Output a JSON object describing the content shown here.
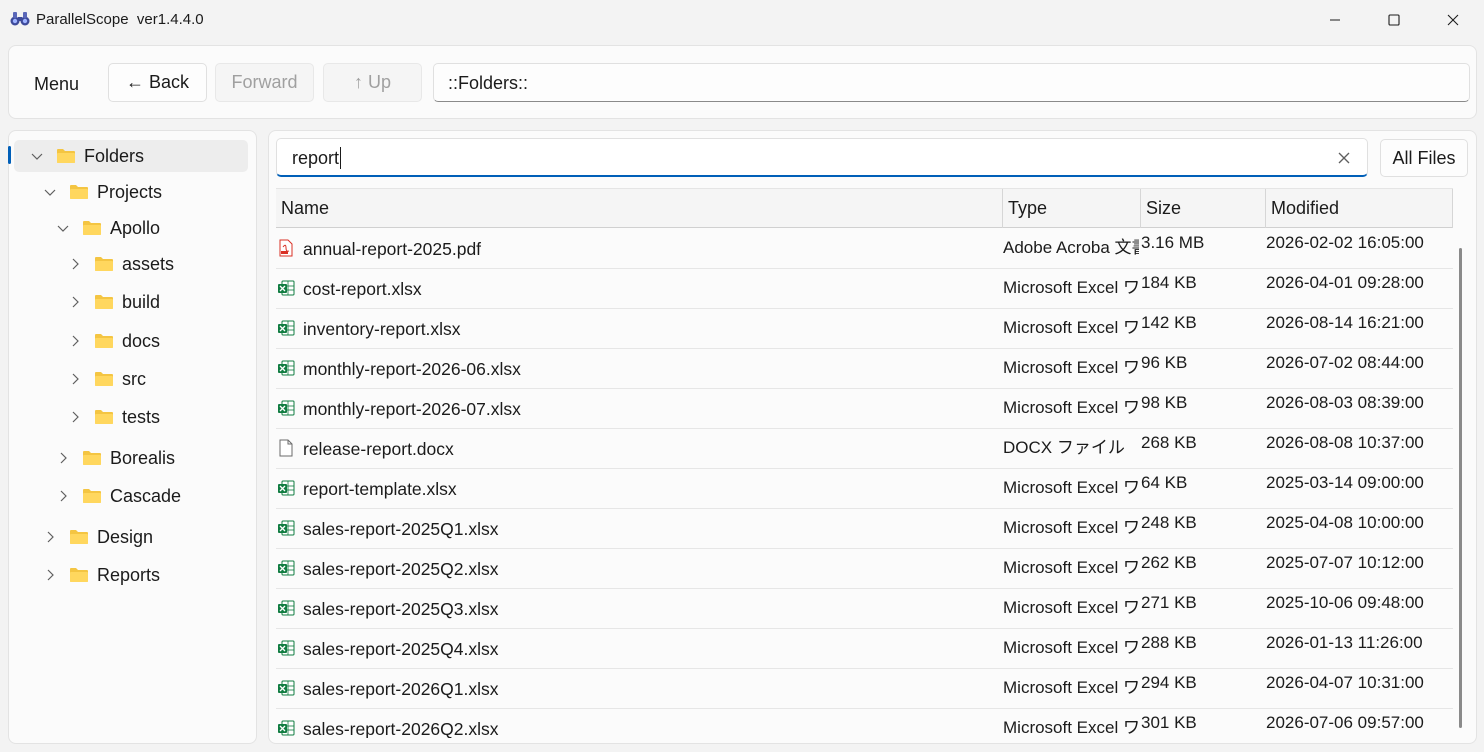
{
  "window": {
    "title": "ParallelScope  ver1.4.4.0",
    "icon": "binoculars-icon"
  },
  "toolbar": {
    "menu": "Menu",
    "back": "← Back",
    "forward": "Forward",
    "up": "↑ Up",
    "path": "::Folders::"
  },
  "tree": {
    "items": [
      {
        "label": "Folders",
        "expanded": true,
        "selected": true
      },
      {
        "label": "Projects",
        "expanded": true
      },
      {
        "label": "Apollo",
        "expanded": true
      },
      {
        "label": "assets",
        "expanded": false
      },
      {
        "label": "build",
        "expanded": false
      },
      {
        "label": "docs",
        "expanded": false
      },
      {
        "label": "src",
        "expanded": false
      },
      {
        "label": "tests",
        "expanded": false
      },
      {
        "label": "Borealis",
        "expanded": false
      },
      {
        "label": "Cascade",
        "expanded": false
      },
      {
        "label": "Design",
        "expanded": false
      },
      {
        "label": "Reports",
        "expanded": false
      }
    ]
  },
  "search": {
    "value": "report",
    "filter": "All Files"
  },
  "table": {
    "columns": [
      "Name",
      "Type",
      "Size",
      "Modified"
    ],
    "rows": [
      {
        "name": "annual-report-2025.pdf",
        "icon": "pdf",
        "type": "Adobe Acroba 文書",
        "size": "3.16 MB",
        "modified": "2026-02-02 16:05:00"
      },
      {
        "name": "cost-report.xlsx",
        "icon": "excel",
        "type": "Microsoft Excel ワークシート",
        "size": "184 KB",
        "modified": "2026-04-01 09:28:00"
      },
      {
        "name": "inventory-report.xlsx",
        "icon": "excel",
        "type": "Microsoft Excel ワークシート",
        "size": "142 KB",
        "modified": "2026-08-14 16:21:00"
      },
      {
        "name": "monthly-report-2026-06.xlsx",
        "icon": "excel",
        "type": "Microsoft Excel ワークシート",
        "size": "96 KB",
        "modified": "2026-07-02 08:44:00"
      },
      {
        "name": "monthly-report-2026-07.xlsx",
        "icon": "excel",
        "type": "Microsoft Excel ワークシート",
        "size": "98 KB",
        "modified": "2026-08-03 08:39:00"
      },
      {
        "name": "release-report.docx",
        "icon": "file",
        "type": "DOCX ファイル",
        "size": "268 KB",
        "modified": "2026-08-08 10:37:00"
      },
      {
        "name": "report-template.xlsx",
        "icon": "excel",
        "type": "Microsoft Excel ワークシート",
        "size": "64 KB",
        "modified": "2025-03-14 09:00:00"
      },
      {
        "name": "sales-report-2025Q1.xlsx",
        "icon": "excel",
        "type": "Microsoft Excel ワークシート",
        "size": "248 KB",
        "modified": "2025-04-08 10:00:00"
      },
      {
        "name": "sales-report-2025Q2.xlsx",
        "icon": "excel",
        "type": "Microsoft Excel ワークシート",
        "size": "262 KB",
        "modified": "2025-07-07 10:12:00"
      },
      {
        "name": "sales-report-2025Q3.xlsx",
        "icon": "excel",
        "type": "Microsoft Excel ワークシート",
        "size": "271 KB",
        "modified": "2025-10-06 09:48:00"
      },
      {
        "name": "sales-report-2025Q4.xlsx",
        "icon": "excel",
        "type": "Microsoft Excel ワークシート",
        "size": "288 KB",
        "modified": "2026-01-13 11:26:00"
      },
      {
        "name": "sales-report-2026Q1.xlsx",
        "icon": "excel",
        "type": "Microsoft Excel ワークシート",
        "size": "294 KB",
        "modified": "2026-04-07 10:31:00"
      },
      {
        "name": "sales-report-2026Q2.xlsx",
        "icon": "excel",
        "type": "Microsoft Excel ワークシート",
        "size": "301 KB",
        "modified": "2026-07-06 09:57:00"
      }
    ]
  },
  "colors": {
    "accent": "#005fb8",
    "folder": "#f4c542",
    "excel": "#107c41",
    "pdf": "#d93025"
  }
}
